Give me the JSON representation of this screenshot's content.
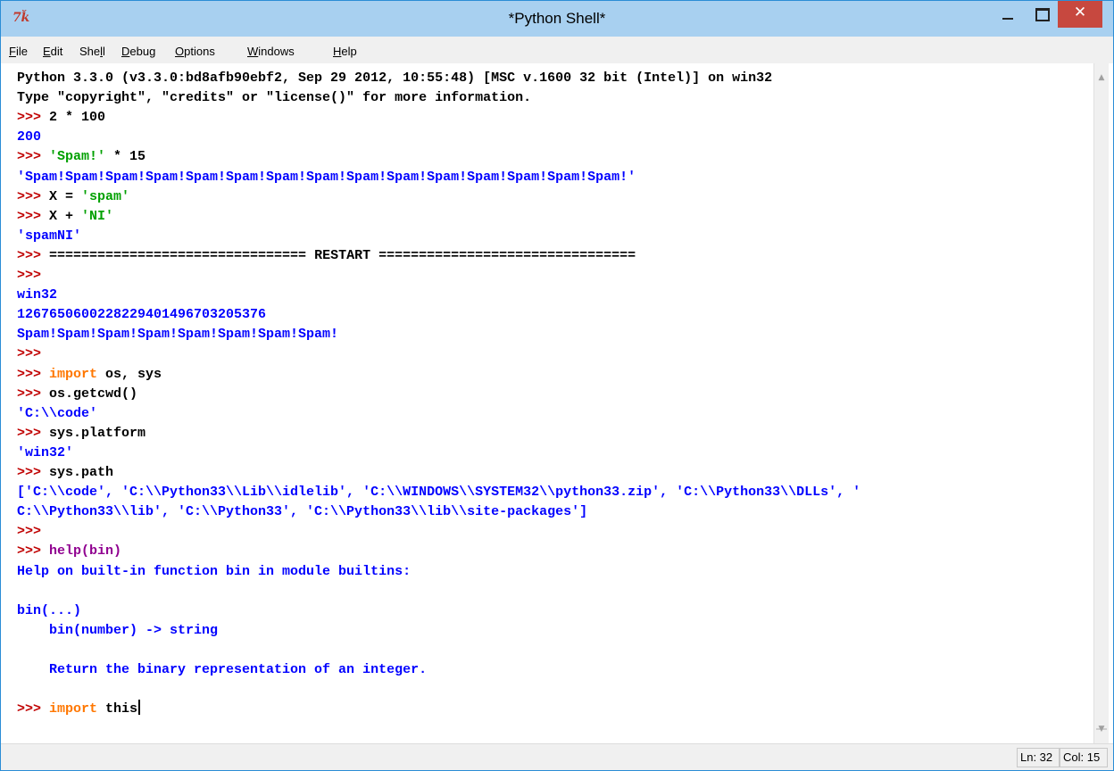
{
  "window": {
    "title": "*Python Shell*",
    "app_icon": "7ǩ",
    "close_glyph": "✕"
  },
  "menu": [
    {
      "pre": "",
      "u": "F",
      "post": "ile"
    },
    {
      "pre": "",
      "u": "E",
      "post": "dit"
    },
    {
      "pre": "She",
      "u": "l",
      "post": "l"
    },
    {
      "pre": "",
      "u": "D",
      "post": "ebug"
    },
    {
      "pre": "",
      "u": "O",
      "post": "ptions"
    },
    {
      "pre": "",
      "u": "W",
      "post": "indows"
    },
    {
      "pre": "",
      "u": "H",
      "post": "elp"
    }
  ],
  "shell_lines": [
    [
      {
        "t": "Python 3.3.0 (v3.3.0:bd8afb90ebf2, Sep 29 2012, 10:55:48) [MSC v.1600 32 bit (Intel)] on win32",
        "c": "plain"
      }
    ],
    [
      {
        "t": "Type \"copyright\", \"credits\" or \"license()\" for more information.",
        "c": "plain"
      }
    ],
    [
      {
        "t": ">>> ",
        "c": "prompt"
      },
      {
        "t": "2 * 100",
        "c": "plain"
      }
    ],
    [
      {
        "t": "200",
        "c": "out"
      }
    ],
    [
      {
        "t": ">>> ",
        "c": "prompt"
      },
      {
        "t": "'Spam!'",
        "c": "str"
      },
      {
        "t": " * 15",
        "c": "plain"
      }
    ],
    [
      {
        "t": "'Spam!Spam!Spam!Spam!Spam!Spam!Spam!Spam!Spam!Spam!Spam!Spam!Spam!Spam!Spam!'",
        "c": "out"
      }
    ],
    [
      {
        "t": ">>> ",
        "c": "prompt"
      },
      {
        "t": "X = ",
        "c": "plain"
      },
      {
        "t": "'spam'",
        "c": "str"
      }
    ],
    [
      {
        "t": ">>> ",
        "c": "prompt"
      },
      {
        "t": "X + ",
        "c": "plain"
      },
      {
        "t": "'NI'",
        "c": "str"
      }
    ],
    [
      {
        "t": "'spamNI'",
        "c": "out"
      }
    ],
    [
      {
        "t": ">>> ",
        "c": "prompt"
      },
      {
        "t": "================================ RESTART ================================",
        "c": "plain"
      }
    ],
    [
      {
        "t": ">>>",
        "c": "prompt"
      }
    ],
    [
      {
        "t": "win32",
        "c": "out"
      }
    ],
    [
      {
        "t": "1267650600228229401496703205376",
        "c": "out"
      }
    ],
    [
      {
        "t": "Spam!Spam!Spam!Spam!Spam!Spam!Spam!Spam!",
        "c": "out"
      }
    ],
    [
      {
        "t": ">>>",
        "c": "prompt"
      }
    ],
    [
      {
        "t": ">>> ",
        "c": "prompt"
      },
      {
        "t": "import",
        "c": "kw"
      },
      {
        "t": " os, sys",
        "c": "plain"
      }
    ],
    [
      {
        "t": ">>> ",
        "c": "prompt"
      },
      {
        "t": "os.getcwd()",
        "c": "plain"
      }
    ],
    [
      {
        "t": "'C:\\\\code'",
        "c": "out"
      }
    ],
    [
      {
        "t": ">>> ",
        "c": "prompt"
      },
      {
        "t": "sys.platform",
        "c": "plain"
      }
    ],
    [
      {
        "t": "'win32'",
        "c": "out"
      }
    ],
    [
      {
        "t": ">>> ",
        "c": "prompt"
      },
      {
        "t": "sys.path",
        "c": "plain"
      }
    ],
    [
      {
        "t": "['C:\\\\code', 'C:\\\\Python33\\\\Lib\\\\idlelib', 'C:\\\\WINDOWS\\\\SYSTEM32\\\\python33.zip', 'C:\\\\Python33\\\\DLLs', '",
        "c": "out"
      }
    ],
    [
      {
        "t": "C:\\\\Python33\\\\lib', 'C:\\\\Python33', 'C:\\\\Python33\\\\lib\\\\site-packages']",
        "c": "out"
      }
    ],
    [
      {
        "t": ">>>",
        "c": "prompt"
      }
    ],
    [
      {
        "t": ">>> ",
        "c": "prompt"
      },
      {
        "t": "help(bin)",
        "c": "blt"
      }
    ],
    [
      {
        "t": "Help on built-in function bin in module builtins:",
        "c": "out"
      }
    ],
    [
      {
        "t": "",
        "c": "out"
      }
    ],
    [
      {
        "t": "bin(...)",
        "c": "out"
      }
    ],
    [
      {
        "t": "    bin(number) -> string",
        "c": "out"
      }
    ],
    [
      {
        "t": "",
        "c": "out"
      }
    ],
    [
      {
        "t": "    Return the binary representation of an integer.",
        "c": "out"
      }
    ],
    [
      {
        "t": "",
        "c": "out"
      }
    ],
    [
      {
        "t": ">>> ",
        "c": "prompt"
      },
      {
        "t": "import",
        "c": "kw"
      },
      {
        "t": " this",
        "c": "plain"
      }
    ]
  ],
  "status": {
    "line": "Ln: 32",
    "col": "Col: 15"
  }
}
